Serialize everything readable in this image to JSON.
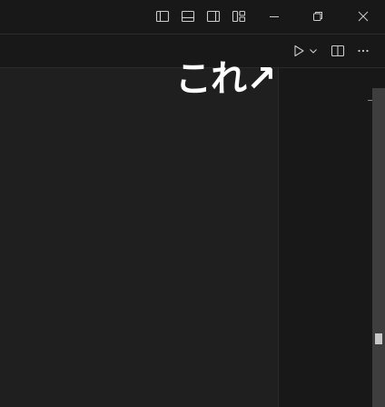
{
  "titlebar": {
    "layout_controls": [
      {
        "name": "toggle-primary-sidebar",
        "icon": "sidebar-left-icon"
      },
      {
        "name": "toggle-panel",
        "icon": "panel-bottom-icon"
      },
      {
        "name": "toggle-secondary-sidebar",
        "icon": "sidebar-right-icon"
      },
      {
        "name": "customize-layout",
        "icon": "layout-grid-icon"
      }
    ],
    "window_controls": [
      {
        "name": "minimize",
        "icon": "minimize-icon"
      },
      {
        "name": "restore",
        "icon": "restore-icon"
      },
      {
        "name": "close",
        "icon": "close-icon"
      }
    ]
  },
  "tabbar": {
    "actions": [
      {
        "name": "run",
        "icon": "play-icon"
      },
      {
        "name": "run-dropdown",
        "icon": "chevron-down-icon"
      },
      {
        "name": "split-editor",
        "icon": "split-editor-icon"
      },
      {
        "name": "more-actions",
        "icon": "ellipsis-icon"
      }
    ]
  },
  "annotation": {
    "text": "これ↗"
  },
  "colors": {
    "titlebar_bg": "#181818",
    "editor_bg": "#1f1f1f",
    "icon": "#cccccc",
    "annotation": "#ffffff"
  }
}
